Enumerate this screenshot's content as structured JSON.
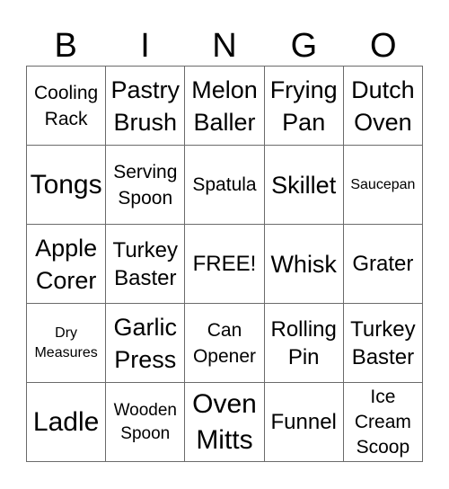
{
  "header": [
    "B",
    "I",
    "N",
    "G",
    "O"
  ],
  "cells": [
    [
      "Cooling\nRack",
      "Pastry\nBrush",
      "Melon\nBaller",
      "Frying\nPan",
      "Dutch\nOven"
    ],
    [
      "Tongs",
      "Serving\nSpoon",
      "Spatula",
      "Skillet",
      "Saucepan"
    ],
    [
      "Apple\nCorer",
      "Turkey\nBaster",
      "FREE!",
      "Whisk",
      "Grater"
    ],
    [
      "Dry\nMeasures",
      "Garlic\nPress",
      "Can\nOpener",
      "Rolling\nPin",
      "Turkey\nBaster"
    ],
    [
      "Ladle",
      "Wooden\nSpoon",
      "Oven\nMitts",
      "Funnel",
      "Ice\nCream\nScoop"
    ]
  ]
}
